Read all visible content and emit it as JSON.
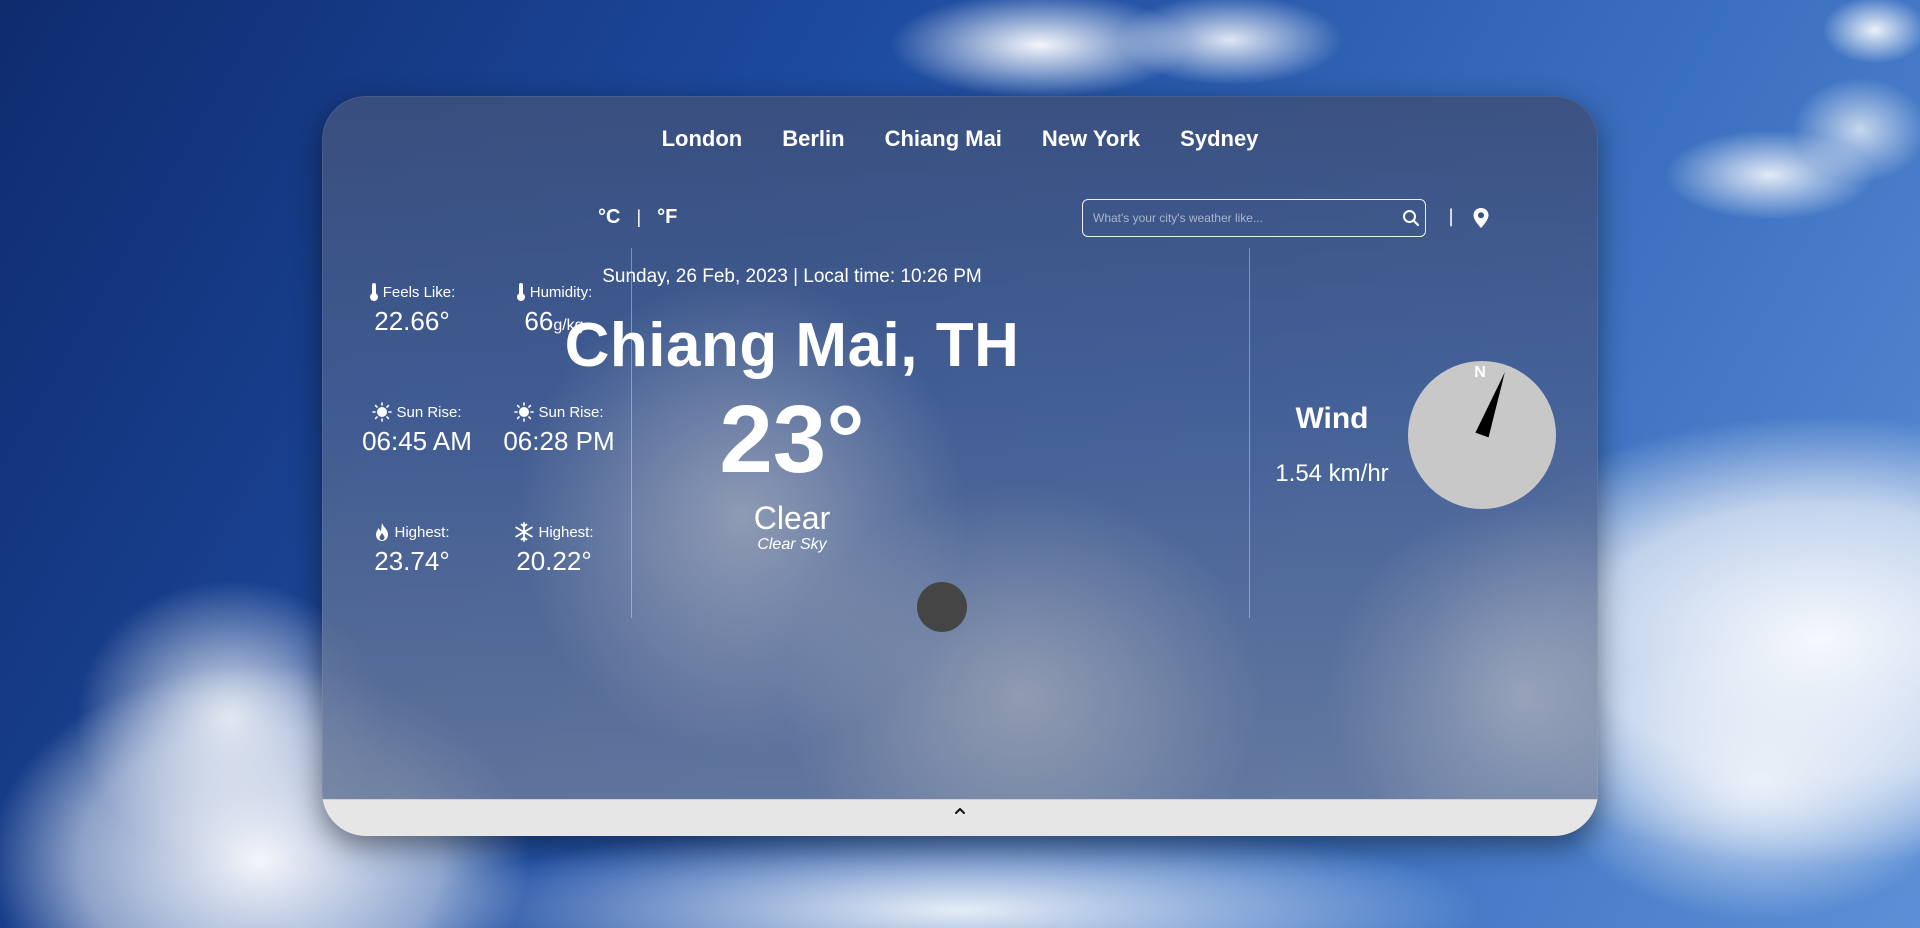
{
  "nav": {
    "cities": [
      "London",
      "Berlin",
      "Chiang Mai",
      "New York",
      "Sydney"
    ]
  },
  "units": {
    "celsius": "°C",
    "separator": "|",
    "fahrenheit": "°F"
  },
  "search": {
    "placeholder": "What's your city's weather like..."
  },
  "location_separator": "|",
  "details": {
    "feels_like": {
      "label": "Feels Like:",
      "value": "22.66°"
    },
    "humidity": {
      "label": "Humidity:",
      "value": "66",
      "unit": "g/kg"
    },
    "sunrise": {
      "label": "Sun Rise:",
      "value": "06:45 AM"
    },
    "sunset": {
      "label": "Sun Rise:",
      "value": "06:28 PM"
    },
    "highest": {
      "label": "Highest:",
      "value": "23.74°"
    },
    "lowest": {
      "label": "Highest:",
      "value": "20.22°"
    }
  },
  "main": {
    "date_time": "Sunday, 26 Feb, 2023 | Local time: 10:26 PM",
    "city": "Chiang Mai, TH",
    "temperature": "23°",
    "condition": "Clear",
    "description": "Clear Sky"
  },
  "wind": {
    "title": "Wind",
    "speed": "1.54 km/hr",
    "compass_label": "N",
    "direction_deg": 20
  },
  "colors": {
    "compass_face": "#c8c8c8",
    "needle": "#000000",
    "weather_icon": "#454545"
  }
}
